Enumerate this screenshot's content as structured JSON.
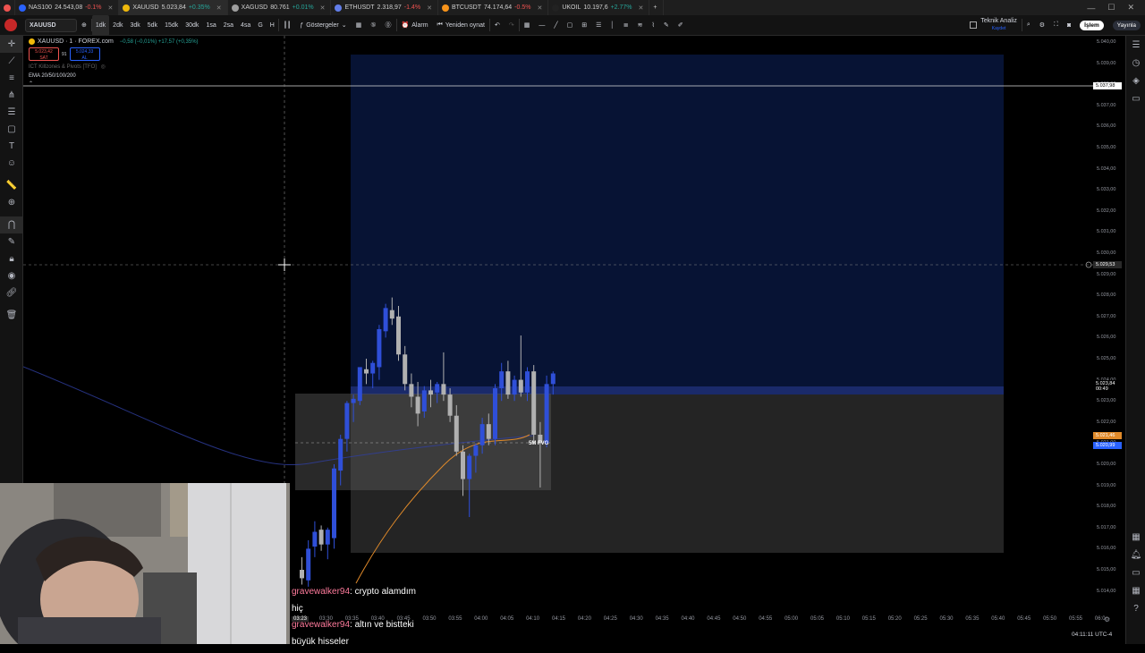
{
  "tabs": [
    {
      "name": "NAS100",
      "price": "24.543,08",
      "change": "-0.1%",
      "dir": "neg",
      "color": "#2962ff"
    },
    {
      "name": "XAUUSD",
      "price": "5.023,84",
      "change": "+0.35%",
      "dir": "pos",
      "color": "#f0b90b"
    },
    {
      "name": "XAGUSD",
      "price": "80.761",
      "change": "+0.01%",
      "dir": "pos",
      "color": "#9e9e9e"
    },
    {
      "name": "ETHUSDT",
      "price": "2.318,97",
      "change": "-1.4%",
      "dir": "neg",
      "color": "#627eea"
    },
    {
      "name": "BTCUSDT",
      "price": "74.174,64",
      "change": "-0.5%",
      "dir": "neg",
      "color": "#f7931a"
    },
    {
      "name": "UKOIL",
      "price": "10.197,6",
      "change": "+2.77%",
      "dir": "pos",
      "color": "#222"
    }
  ],
  "toolbar": {
    "symbol": "XAUUSD",
    "timeframes": [
      "1dk",
      "2dk",
      "3dk",
      "5dk",
      "15dk",
      "30dk",
      "1sa",
      "2sa",
      "4sa",
      "G",
      "H"
    ],
    "active_tf": "1dk",
    "indicators": "Göstergeler",
    "alarm": "Alarm",
    "replay": "Yeniden oynat",
    "tech_analysis": "Teknik Analiz",
    "tech_analysis_sub": "Kaydet",
    "trade": "İşlem",
    "publish": "Yayınla"
  },
  "legend": {
    "title": "XAUUSD · 1 · FOREX.com",
    "change": "−0,58 (−0,01%) +17,57 (+0,35%)",
    "sell_price": "5.023,42",
    "sell_label": "SAT",
    "spread": "91",
    "buy_price": "5.024,33",
    "buy_label": "AL",
    "indicator1": "ICT Killzones & Pivots [TFO]",
    "indicator2": "EMA 20/50/100/200"
  },
  "annotations": {
    "fvg_label": "5M FVG"
  },
  "price_axis": {
    "ticks": [
      "5.040,00",
      "5.039,00",
      "5.038,00",
      "5.037,00",
      "5.036,00",
      "5.035,00",
      "5.034,00",
      "5.033,00",
      "5.032,00",
      "5.031,00",
      "5.030,00",
      "5.029,00",
      "5.028,00",
      "5.027,00",
      "5.026,00",
      "5.025,00",
      "5.024,00",
      "5.023,00",
      "5.022,00",
      "5.021,00",
      "5.020,00",
      "5.019,00",
      "5.018,00",
      "5.017,00",
      "5.016,00",
      "5.015,00",
      "5.014,00"
    ],
    "hline_label": "5.037,98",
    "crosshair_label": "5.029,53",
    "last_price": "5.023,84",
    "countdown": "00:49",
    "ema1": "5.021,46",
    "ema2": "5.020,99"
  },
  "time_axis": {
    "ticks": [
      "03:23",
      "03:30",
      "03:35",
      "03:40",
      "03:45",
      "03:50",
      "03:55",
      "04:00",
      "04:05",
      "04:10",
      "04:15",
      "04:20",
      "04:25",
      "04:30",
      "04:35",
      "04:40",
      "04:45",
      "04:50",
      "04:55",
      "05:00",
      "05:05",
      "05:10",
      "05:15",
      "05:20",
      "05:25",
      "05:30",
      "05:35",
      "05:40",
      "05:45",
      "05:50",
      "05:55",
      "06:0"
    ]
  },
  "clock": "04:11:11 UTC-4",
  "chat": [
    {
      "user": "gravewalker94",
      "msg": ": crypto alamdım"
    },
    {
      "user": "",
      "msg": "hiç"
    },
    {
      "user": "gravewalker94",
      "msg": ": altın ve bistteki"
    },
    {
      "user": "",
      "msg": "büyük hisseler"
    }
  ],
  "colors": {
    "bull": "#2f4fd8",
    "bear": "#b0b0b0",
    "zone": "#0a1a45",
    "fvg": "#3a3a3a"
  },
  "chart_data": {
    "type": "candlestick",
    "candles": [
      {
        "o": 5015.0,
        "h": 5015.6,
        "l": 5014.3,
        "c": 5014.6
      },
      {
        "o": 5014.5,
        "h": 5016.4,
        "l": 5014.2,
        "c": 5016.0
      },
      {
        "o": 5016.1,
        "h": 5017.3,
        "l": 5015.6,
        "c": 5016.8
      },
      {
        "o": 5016.9,
        "h": 5017.1,
        "l": 5015.9,
        "c": 5016.2
      },
      {
        "o": 5016.2,
        "h": 5017.0,
        "l": 5015.5,
        "c": 5016.9
      },
      {
        "o": 5016.5,
        "h": 5020.0,
        "l": 5016.0,
        "c": 5019.8
      },
      {
        "o": 5019.7,
        "h": 5021.4,
        "l": 5019.0,
        "c": 5021.2
      },
      {
        "o": 5021.2,
        "h": 5023.0,
        "l": 5020.6,
        "c": 5022.9
      },
      {
        "o": 5022.9,
        "h": 5023.3,
        "l": 5022.0,
        "c": 5023.1
      },
      {
        "o": 5023.0,
        "h": 5024.6,
        "l": 5022.8,
        "c": 5024.6
      },
      {
        "o": 5024.5,
        "h": 5025.0,
        "l": 5023.8,
        "c": 5024.3
      },
      {
        "o": 5024.3,
        "h": 5024.9,
        "l": 5023.6,
        "c": 5024.8
      },
      {
        "o": 5024.6,
        "h": 5026.6,
        "l": 5024.0,
        "c": 5026.4
      },
      {
        "o": 5026.3,
        "h": 5027.6,
        "l": 5026.0,
        "c": 5027.4
      },
      {
        "o": 5027.3,
        "h": 5027.9,
        "l": 5026.6,
        "c": 5026.9
      },
      {
        "o": 5027.0,
        "h": 5027.5,
        "l": 5024.9,
        "c": 5025.2
      },
      {
        "o": 5025.2,
        "h": 5025.6,
        "l": 5023.5,
        "c": 5023.8
      },
      {
        "o": 5023.8,
        "h": 5024.3,
        "l": 5022.7,
        "c": 5023.2
      },
      {
        "o": 5023.2,
        "h": 5023.9,
        "l": 5021.8,
        "c": 5022.4
      },
      {
        "o": 5022.5,
        "h": 5023.7,
        "l": 5022.2,
        "c": 5023.5
      },
      {
        "o": 5023.5,
        "h": 5024.0,
        "l": 5022.7,
        "c": 5023.3
      },
      {
        "o": 5023.4,
        "h": 5023.9,
        "l": 5022.9,
        "c": 5023.8
      },
      {
        "o": 5023.8,
        "h": 5025.3,
        "l": 5023.0,
        "c": 5023.3
      },
      {
        "o": 5023.3,
        "h": 5023.6,
        "l": 5022.0,
        "c": 5022.3
      },
      {
        "o": 5022.3,
        "h": 5022.8,
        "l": 5020.4,
        "c": 5020.6
      },
      {
        "o": 5020.6,
        "h": 5020.9,
        "l": 5018.5,
        "c": 5019.3
      },
      {
        "o": 5019.3,
        "h": 5020.5,
        "l": 5017.5,
        "c": 5020.4
      },
      {
        "o": 5020.4,
        "h": 5021.0,
        "l": 5019.6,
        "c": 5020.9
      },
      {
        "o": 5020.9,
        "h": 5022.2,
        "l": 5020.5,
        "c": 5021.9
      },
      {
        "o": 5021.9,
        "h": 5022.4,
        "l": 5020.9,
        "c": 5021.2
      },
      {
        "o": 5021.2,
        "h": 5023.8,
        "l": 5020.9,
        "c": 5023.6
      },
      {
        "o": 5023.6,
        "h": 5024.8,
        "l": 5023.0,
        "c": 5024.4
      },
      {
        "o": 5024.4,
        "h": 5024.9,
        "l": 5023.1,
        "c": 5023.3
      },
      {
        "o": 5023.3,
        "h": 5024.2,
        "l": 5023.0,
        "c": 5024.0
      },
      {
        "o": 5024.0,
        "h": 5026.1,
        "l": 5023.2,
        "c": 5023.4
      },
      {
        "o": 5023.4,
        "h": 5024.6,
        "l": 5023.0,
        "c": 5024.4
      },
      {
        "o": 5024.4,
        "h": 5024.7,
        "l": 5021.0,
        "c": 5021.4
      },
      {
        "o": 5021.4,
        "h": 5022.0,
        "l": 5018.9,
        "c": 5021.0
      },
      {
        "o": 5021.0,
        "h": 5024.2,
        "l": 5020.8,
        "c": 5023.8
      },
      {
        "o": 5023.8,
        "h": 5024.4,
        "l": 5023.3,
        "c": 5024.3
      }
    ]
  }
}
